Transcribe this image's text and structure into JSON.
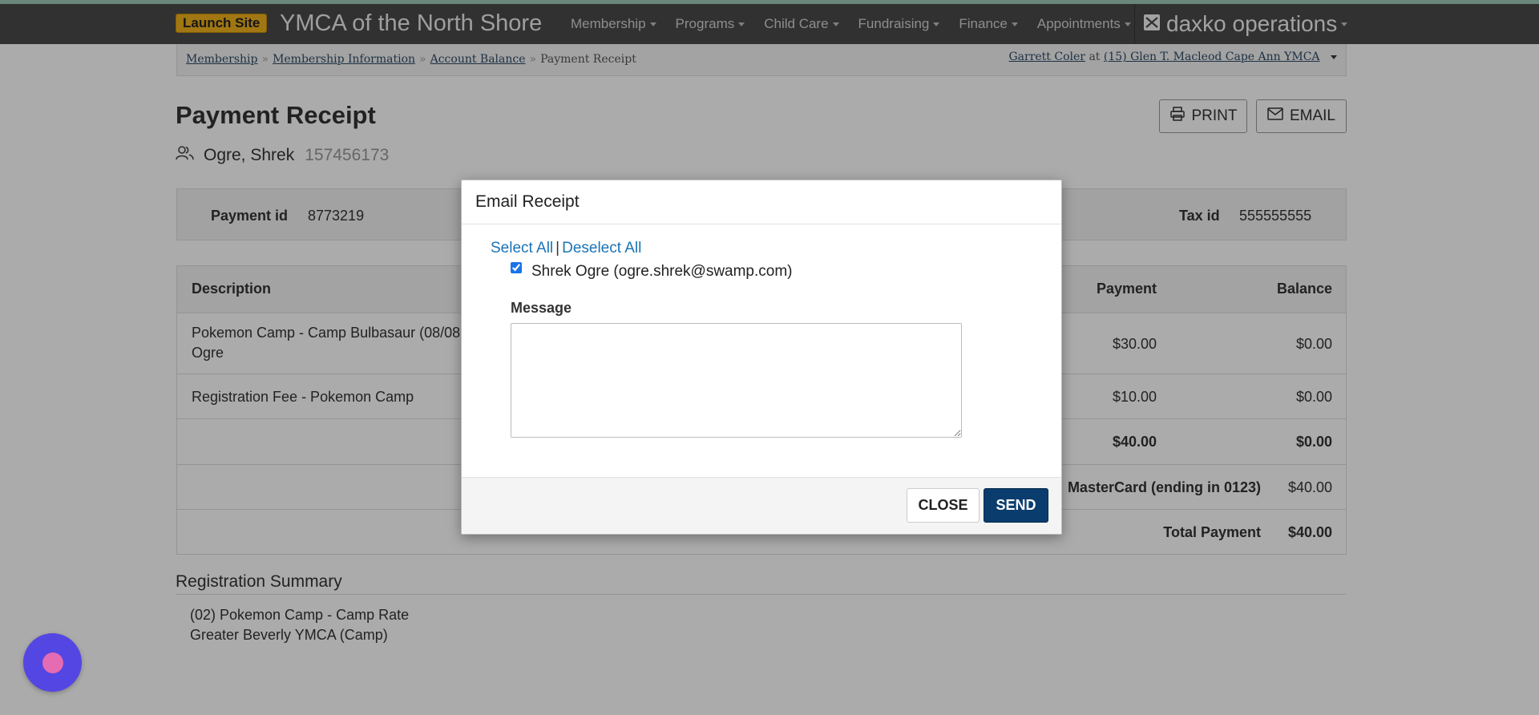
{
  "nav": {
    "launch_label": "Launch Site",
    "brand": "YMCA of the North Shore",
    "menu": [
      "Membership",
      "Programs",
      "Child Care",
      "Fundraising",
      "Finance",
      "Appointments"
    ],
    "product": "daxko operations",
    "product_icon": "envelope-x-icon"
  },
  "breadcrumb": {
    "items": [
      "Membership",
      "Membership Information",
      "Account Balance",
      "Payment Receipt"
    ],
    "separator": "»"
  },
  "user_context": {
    "user": "Garrett Coler",
    "at": "at",
    "location": "(15) Glen T. Macleod Cape Ann YMCA"
  },
  "page": {
    "title": "Payment Receipt",
    "print_label": "PRINT",
    "email_label": "EMAIL",
    "person_name": "Ogre, Shrek",
    "person_id": "157456173"
  },
  "ids": {
    "payment_label": "Payment id",
    "payment_value": "8773219",
    "tax_label": "Tax id",
    "tax_value": "555555555"
  },
  "table": {
    "headers": {
      "description": "Description",
      "payment": "Payment",
      "balance": "Balance"
    },
    "rows": [
      {
        "desc_line1": "Pokemon Camp - Camp Bulbasaur (08/08",
        "desc_line2": "Ogre",
        "payment": "$30.00",
        "balance": "$0.00"
      },
      {
        "desc_line1": "Registration Fee - Pokemon Camp",
        "payment": "$10.00",
        "balance": "$0.00"
      }
    ],
    "subtotal": {
      "payment": "$40.00",
      "balance": "$0.00"
    },
    "method": {
      "label": "MasterCard (ending in 0123)",
      "amount": "$40.00"
    },
    "total": {
      "label": "Total Payment",
      "amount": "$40.00"
    }
  },
  "registration": {
    "title": "Registration Summary",
    "line1": "(02) Pokemon Camp - Camp Rate",
    "line2": "Greater Beverly YMCA (Camp)"
  },
  "modal": {
    "title": "Email Receipt",
    "select_all": "Select All",
    "deselect_all": "Deselect All",
    "divider": "|",
    "recipient": "Shrek Ogre (ogre.shrek@swamp.com)",
    "recipient_checked": true,
    "message_label": "Message",
    "message_value": "",
    "close_label": "CLOSE",
    "send_label": "SEND"
  },
  "colors": {
    "navbar": "#4a4a4a",
    "launch": "#f0b21d",
    "link": "#1a73b5",
    "send": "#0a3d6e",
    "chat": "#5446e2"
  }
}
